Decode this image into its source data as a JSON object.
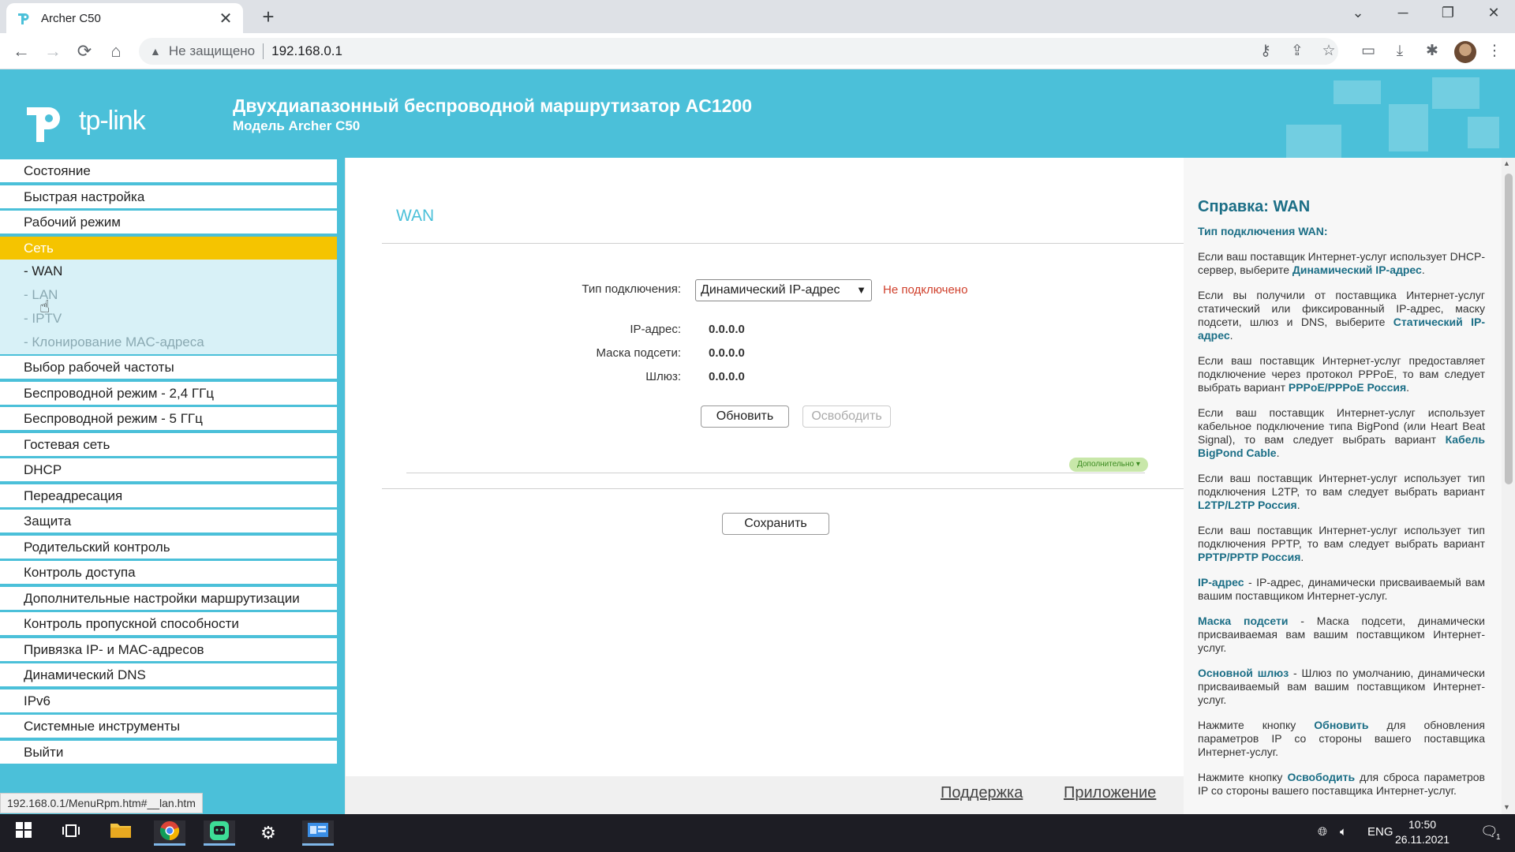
{
  "browser": {
    "tab_title": "Archer C50",
    "tab_close": "✕",
    "new_tab": "+",
    "security_label": "Не защищено",
    "url": "192.168.0.1",
    "status_url": "192.168.0.1/MenuRpm.htm#__lan.htm",
    "window_controls": {
      "minimize": "─",
      "restore": "❐",
      "close": "✕",
      "tab_search": "⌄"
    },
    "nav": {
      "back": "←",
      "forward": "→",
      "reload": "⟳",
      "home": "⌂"
    },
    "toolbar_icons": {
      "key": "⚷",
      "share": "⇪",
      "bookmark": "☆",
      "cast": "▭",
      "download": "⤓",
      "extensions": "✱",
      "menu": "⋮"
    }
  },
  "router": {
    "logo_text": "tp-link",
    "header_title": "Двухдиапазонный беспроводной маршрутизатор AC1200",
    "header_model": "Модель Archer C50",
    "sidebar": {
      "items_top": [
        "Состояние",
        "Быстрая настройка",
        "Рабочий режим",
        "Сеть"
      ],
      "subitems": [
        "- WAN",
        "- LAN",
        "- IPTV",
        "- Клонирование MAC-адреса"
      ],
      "items_bottom": [
        "Выбор рабочей частоты",
        "Беспроводной режим - 2,4 ГГц",
        "Беспроводной режим - 5 ГГц",
        "Гостевая сеть",
        "DHCP",
        "Переадресация",
        "Защита",
        "Родительский контроль",
        "Контроль доступа",
        "Дополнительные настройки маршрутизации",
        "Контроль пропускной способности",
        "Привязка IP- и MAC-адресов",
        "Динамический DNS",
        "IPv6",
        "Системные инструменты",
        "Выйти"
      ]
    },
    "main": {
      "section_title": "WAN",
      "connection_type_label": "Тип подключения:",
      "connection_type_value": "Динамический IP-адрес",
      "connection_status": "Не подключено",
      "ip_label": "IP-адрес:",
      "ip_value": "0.0.0.0",
      "mask_label": "Маска подсети:",
      "mask_value": "0.0.0.0",
      "gateway_label": "Шлюз:",
      "gateway_value": "0.0.0.0",
      "refresh_button": "Обновить",
      "release_button": "Освободить",
      "advanced_toggle": "Дополнительно ▾",
      "save_button": "Сохранить",
      "footer_support": "Поддержка",
      "footer_app": "Приложение"
    },
    "help": {
      "title": "Справка: WAN",
      "subtitle": "Тип подключения WAN:",
      "p1_a": "Если ваш поставщик Интернет-услуг использует DHCP-сервер, выберите ",
      "p1_b": "Динамический IP-адрес",
      "p2_a": "Если вы получили от поставщика Интернет-услуг статический или фиксированный IP-адрес, маску подсети, шлюз и DNS, выберите ",
      "p2_b": "Статический IP-адрес",
      "p3_a": "Если ваш поставщик Интернет-услуг предоставляет подключение через протокол PPPoE, то вам следует выбрать вариант ",
      "p3_b": "PPPoE/PPPoE Россия",
      "p4_a": "Если ваш поставщик Интернет-услуг использует кабельное подключение типа BigPond (или Heart Beat Signal), то вам следует выбрать вариант ",
      "p4_b": "Кабель BigPond Cable",
      "p5_a": "Если ваш поставщик Интернет-услуг использует тип подключения L2TP, то вам следует выбрать вариант ",
      "p5_b": "L2TP/L2TP Россия",
      "p6_a": "Если ваш поставщик Интернет-услуг использует тип подключения PPTP, то вам следует выбрать вариант ",
      "p6_b": "PPTP/PPTP Россия",
      "p7_a": "IP-адрес",
      "p7_b": " - IP-адрес, динамически присваиваемый вам вашим поставщиком Интернет-услуг.",
      "p8_a": "Маска подсети",
      "p8_b": " - Маска подсети, динамически присваиваемая вам вашим поставщиком Интернет-услуг.",
      "p9_a": "Основной шлюз",
      "p9_b": " - Шлюз по умолчанию, динамически присваиваемый вам вашим поставщиком Интернет-услуг.",
      "p10_a": "Нажмите кнопку ",
      "p10_b": "Обновить",
      "p10_c": " для обновления параметров IP со стороны вашего поставщика Интернет-услуг.",
      "p11_a": "Нажмите кнопку ",
      "p11_b": "Освободить",
      "p11_c": " для сброса параметров IP со стороны вашего поставщика Интернет-услуг."
    }
  },
  "taskbar": {
    "language": "ENG",
    "time": "10:50",
    "date": "26.11.2021",
    "notification_count": "1"
  },
  "colors": {
    "brand": "#4bc0d9",
    "active_menu": "#f5c400",
    "help_highlight": "#1b6e86",
    "status_red": "#d0412d"
  }
}
